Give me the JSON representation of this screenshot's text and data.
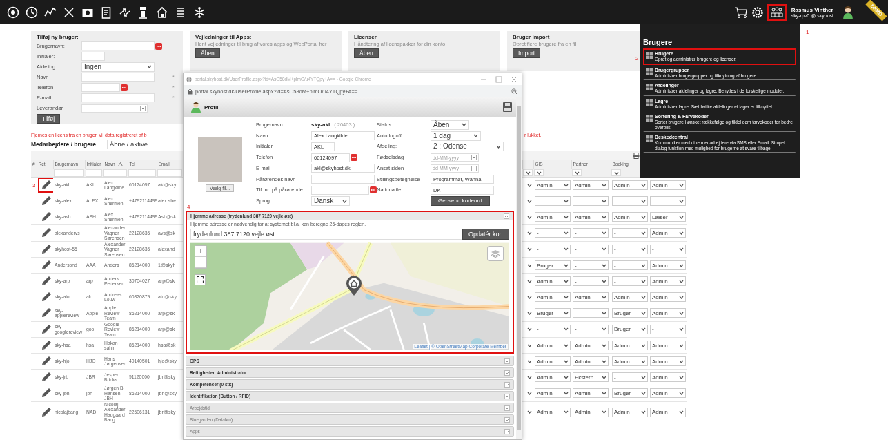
{
  "top_bar": {
    "users_button": {
      "highlighted": true,
      "marker": "1"
    },
    "user": {
      "name": "Rasmus Vinther",
      "account": "sky-rpv0 @ skyhost"
    },
    "ribbon": "DEMO"
  },
  "users_menu": {
    "title": "Brugere",
    "items": [
      {
        "title": "Brugere",
        "description": "Opret og administrer brugere og licenser.",
        "highlighted": true,
        "marker": "2"
      },
      {
        "title": "Brugergrupper",
        "description": "Administrer brugergrupper og tilknytning af brugere.",
        "highlighted": false
      },
      {
        "title": "Afdelinger",
        "description": "Administrer afdelinger og lagre. Benyttes i de forskellige moduler.",
        "highlighted": false
      },
      {
        "title": "Lagre",
        "description": "Administrer lagre. Sæt hvilke afdelinger et lager er tilknyttet.",
        "highlighted": false
      },
      {
        "title": "Sortering & Farvekoder",
        "description": "Sorter brugere i ønsket rækkefølge og tildel dem farvekoder for bedre overblik.",
        "highlighted": false
      },
      {
        "title": "Beskedcentral",
        "description": "Kommuniker med dine medarbejdere via SMS eller Email. Simpel dialog funktion med mulighed for brugerne at svare tilbage.",
        "highlighted": false
      }
    ]
  },
  "add_user": {
    "title": "Tilføj ny bruger:",
    "fields": [
      {
        "label": "Brugernavn:",
        "kind": "text",
        "picker": true
      },
      {
        "label": "Initialer:",
        "kind": "short"
      },
      {
        "label": "Afdeling",
        "kind": "select_wide",
        "value": "Ingen"
      },
      {
        "label": "Navn",
        "kind": "text",
        "mark": "*"
      },
      {
        "label": "Telefon",
        "kind": "medium",
        "picker": true,
        "mark": "*"
      },
      {
        "label": "E-mail",
        "kind": "text",
        "mark": "*"
      },
      {
        "label": "Leverandør",
        "kind": "combo"
      }
    ],
    "button": "Tilføj"
  },
  "info_panels": [
    {
      "title": "Vejledninger til Apps:",
      "text": "Hent vejledninger til brug af vores apps og WebPortal her",
      "button": "Åben"
    },
    {
      "title": "Licenser",
      "text": "Håndtering af licenspakker for din konto",
      "button": "Åben"
    },
    {
      "title": "Bruger import",
      "text": "Opret flere brugere fra en fil",
      "button": "Import"
    }
  ],
  "notice": {
    "left": "Fjernes en licens fra en bruger, vil data registreret af b",
    "right": "r lukket."
  },
  "list_header": {
    "title": "Medarbejdere / brugere",
    "filter": "Åbne / aktive"
  },
  "table": {
    "columns": [
      {
        "label": "#",
        "sorted": false
      },
      {
        "label": "Ret",
        "sorted": false
      },
      {
        "label": "Brugernavn",
        "sorted": false
      },
      {
        "label": "Initialer",
        "sorted": false
      },
      {
        "label": "Navn",
        "sorted": true
      },
      {
        "label": "Tel",
        "sorted": false
      },
      {
        "label": "Email",
        "sorted": false
      }
    ],
    "role_columns": [
      "GIS",
      "Partner",
      "Booking"
    ],
    "rows": [
      {
        "username": "sky-akl",
        "initials": "AKL",
        "name": "Alex Langkilde",
        "phone": "60124097",
        "email": "akl@sky",
        "roles": [
          "Admin",
          "Admin",
          "Admin",
          "Admin"
        ],
        "highlighted": true,
        "marker": "3"
      },
      {
        "username": "sky-alex",
        "initials": "ALEX",
        "name": "Alex Shermen",
        "phone": "+4792114499",
        "email": "alex.she",
        "roles": [
          "-",
          "-",
          "-",
          "-"
        ],
        "highlighted": false
      },
      {
        "username": "sky-ash",
        "initials": "ASH",
        "name": "Alex Shermen",
        "phone": "+4792114499",
        "email": "Ash@sk",
        "roles": [
          "Admin",
          "Admin",
          "Admin",
          "Læser"
        ],
        "highlighted": false
      },
      {
        "username": "alexandervs",
        "name": "Alexander Vagner Sørensen",
        "phone": "22128635",
        "email": "avs@sk",
        "roles": [
          "-",
          "-",
          "-",
          "Admin"
        ],
        "highlighted": false
      },
      {
        "username": "skyhost-55",
        "name": "Alexander Vagner Sørensen",
        "phone": "22128635",
        "email": "alexand",
        "roles": [
          "-",
          "-",
          "-",
          "-"
        ],
        "highlighted": false
      },
      {
        "username": "Andersond",
        "initials": "AAA",
        "name": "Anders",
        "phone": "86214000",
        "email": "1@skyh",
        "roles": [
          "Bruger",
          "-",
          "-",
          "Admin"
        ],
        "highlighted": false
      },
      {
        "username": "sky-arp",
        "initials": "arp",
        "name": "Anders Pedersen",
        "phone": "30704027",
        "email": "arp@sk",
        "roles": [
          "Admin",
          "-",
          "-",
          "Admin"
        ],
        "highlighted": false
      },
      {
        "username": "sky-alo",
        "initials": "alo",
        "name": "Andreas Louw",
        "phone": "60820879",
        "email": "alo@sky",
        "roles": [
          "Admin",
          "Admin",
          "Admin",
          "Admin"
        ],
        "highlighted": false
      },
      {
        "username": "sky-applereview",
        "initials": "Apple",
        "name": "Apple Review Team",
        "phone": "86214000",
        "email": "arp@sk",
        "roles": [
          "Bruger",
          "-",
          "Bruger",
          "Admin"
        ],
        "highlighted": false
      },
      {
        "username": "sky-googlereview",
        "initials": "goo",
        "name": "Google Review Team",
        "phone": "86214000",
        "email": "arp@sk",
        "roles": [
          "-",
          "-",
          "Bruger",
          "-"
        ],
        "highlighted": false
      },
      {
        "username": "sky-hsa",
        "initials": "hsa",
        "name": "Hakan sahin",
        "phone": "86214000",
        "email": "hsa@sk",
        "roles": [
          "Admin",
          "Admin",
          "Admin",
          "Admin"
        ],
        "highlighted": false
      },
      {
        "username": "sky-hjo",
        "initials": "HJO",
        "name": "Hans Jørgensen",
        "phone": "40140501",
        "email": "hjo@sky",
        "roles": [
          "Admin",
          "Admin",
          "Admin",
          "Admin"
        ],
        "highlighted": false
      },
      {
        "username": "sky-jrb",
        "initials": "JBR",
        "name": "Jesper Brinks",
        "phone": "91120000",
        "email": "jbr@sky",
        "roles": [
          "Admin",
          "Ekstern",
          "-",
          "Admin"
        ],
        "highlighted": false
      },
      {
        "username": "sky-jbh",
        "initials": "jbh",
        "name": "Jørgen B. Hansen JBH",
        "phone": "86214000",
        "email": "jbh@sky",
        "roles": [
          "Admin",
          "Admin",
          "Bruger",
          "Admin"
        ],
        "highlighted": false
      },
      {
        "username": "nicolajbang",
        "initials": "NAD",
        "name": "Nicolaj Alexander Haugaard Bang",
        "phone": "22506131",
        "email": "jbr@sky",
        "roles": [
          "Admin",
          "Admin",
          "Admin",
          "Admin"
        ],
        "highlighted": false
      }
    ]
  },
  "profile_window": {
    "window_title": "portal.skyhost.dk/UserProfile.aspx?id=AsO58dM+plmO/u4YTQpy+A== - Google Chrome",
    "url": "portal.skyhost.dk/UserProfile.aspx?id=AsO58dM+plmO/u4YTQpy+A==",
    "heading": "Profil",
    "choose_file": "Vælg fil...",
    "username_label": "Brugernavn:",
    "username": "sky-akl",
    "user_id": "( 20403 )",
    "left_fields": [
      {
        "label": "Navn:",
        "kind": "text",
        "value": "Alex Langkilde"
      },
      {
        "label": "Initialer",
        "kind": "short",
        "value": "AKL"
      },
      {
        "label": "Telefon",
        "kind": "medium",
        "value": "60124097",
        "picker": true
      },
      {
        "label": "E-mail",
        "kind": "text",
        "value": "akl@skyhost.dk"
      },
      {
        "label": "Pårørendes navn",
        "kind": "text"
      },
      {
        "label": "Tlf. nr. på pårørende",
        "kind": "text",
        "picker": true
      },
      {
        "label": "Sprog",
        "kind": "select_short",
        "value": "Dansk"
      }
    ],
    "right_fields": [
      {
        "label": "Status:",
        "kind": "select_short",
        "value": "Åben"
      },
      {
        "label": "Auto logoff:",
        "kind": "select",
        "value": "1 dag"
      },
      {
        "label": "Afdeling:",
        "kind": "select_wide",
        "value": "2 : Odense"
      },
      {
        "label": "Fødselsdag",
        "kind": "date",
        "placeholder": "dd-MM-yyyy"
      },
      {
        "label": "Ansat siden",
        "kind": "date",
        "placeholder": "dd-MM-yyyy"
      },
      {
        "label": "Stillingsbetegnelse",
        "kind": "text",
        "value": "Programmør, Wanna"
      },
      {
        "label": "Nationalitet",
        "kind": "text",
        "value": "DK"
      }
    ],
    "resend_button": "Gensend kodeord",
    "address": {
      "title": "Hjemme adresse (frydenlund 387 7120 vejle øst)",
      "note": "Hjemme adresse er nødvendig for at systemet bl.a. kan beregne 25-dages reglen.",
      "value": "frydenlund 387 7120 vejle øst",
      "button": "Opdatér kort",
      "zoom_in": "+",
      "zoom_out": "−",
      "attribution": "Leaflet | © OpenStreetMap Corporate Member",
      "highlighted": true,
      "marker": "4"
    },
    "sections": [
      {
        "title": "GPS",
        "disabled": false
      },
      {
        "title": "Rettigheder: Administrator",
        "disabled": false
      },
      {
        "title": "Kompetencer (0 stk)",
        "disabled": false
      },
      {
        "title": "Identifikation (Button / RFID)",
        "disabled": false
      },
      {
        "title": "Arbejdstid",
        "disabled": true
      },
      {
        "title": "Bluegarden (Dataløn)",
        "disabled": true
      },
      {
        "title": "Apps",
        "disabled": true
      }
    ]
  }
}
